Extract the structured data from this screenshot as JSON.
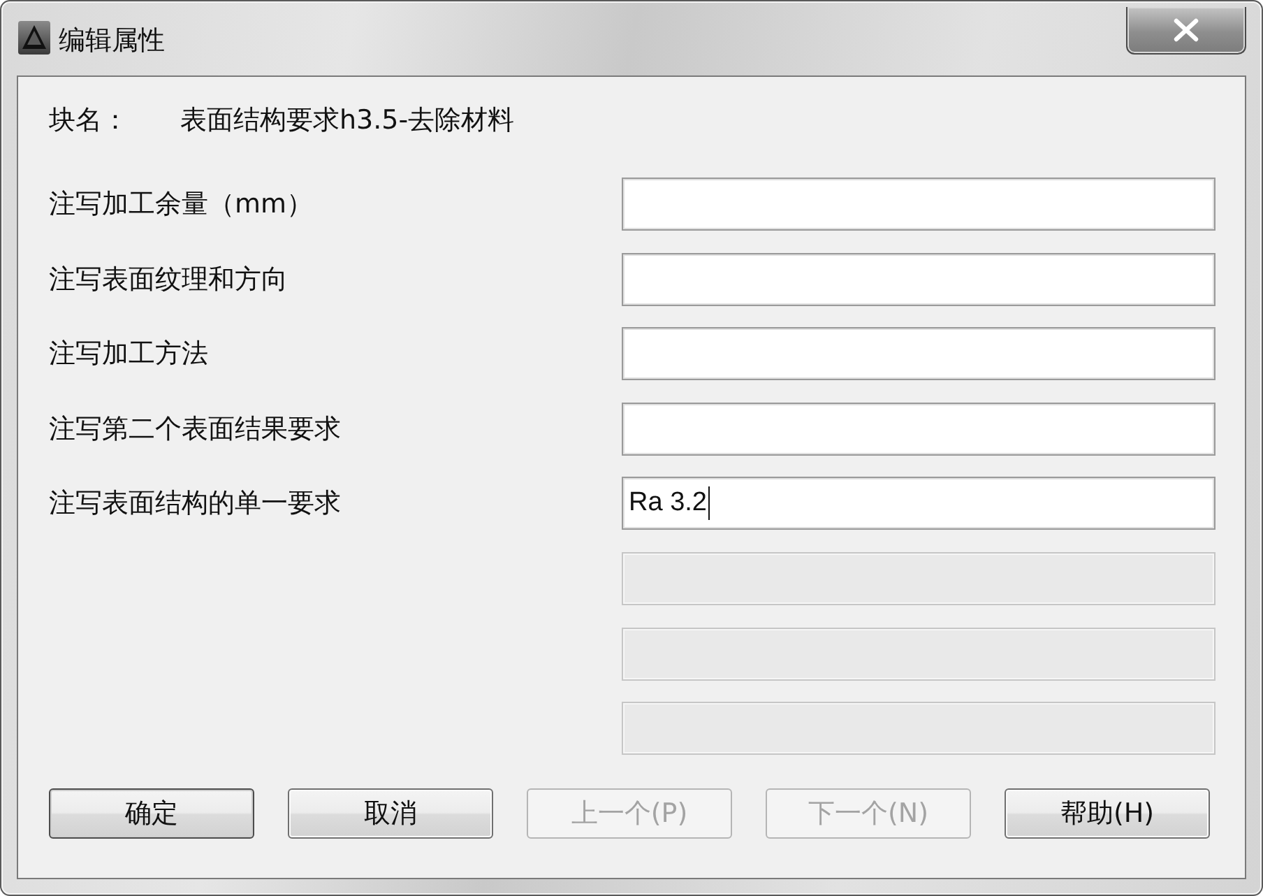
{
  "window": {
    "title": "编辑属性"
  },
  "block_name": {
    "label": "块名：",
    "value": "表面结构要求h3.5-去除材料"
  },
  "attributes": [
    {
      "label": "注写加工余量（mm）",
      "disabled": false,
      "focused": false
    },
    {
      "label": "注写表面纹理和方向",
      "disabled": false,
      "focused": false
    },
    {
      "label": "注写加工方法",
      "disabled": false,
      "focused": false
    },
    {
      "label": "注写第二个表面结果要求",
      "disabled": false,
      "focused": false
    },
    {
      "label": "注写表面结构的单一要求",
      "value": "Ra 3.2",
      "disabled": false,
      "focused": true
    },
    {
      "disabled": true,
      "focused": false
    },
    {
      "disabled": true,
      "focused": false
    },
    {
      "disabled": true,
      "focused": false
    }
  ],
  "buttons": [
    {
      "label": "确定",
      "disabled": false,
      "default": true
    },
    {
      "label": "取消",
      "disabled": false,
      "default": false
    },
    {
      "label": "上一个(P)",
      "disabled": true,
      "default": false
    },
    {
      "label": "下一个(N)",
      "disabled": true,
      "default": false
    },
    {
      "label": "帮助(H)",
      "disabled": false,
      "default": false
    }
  ]
}
